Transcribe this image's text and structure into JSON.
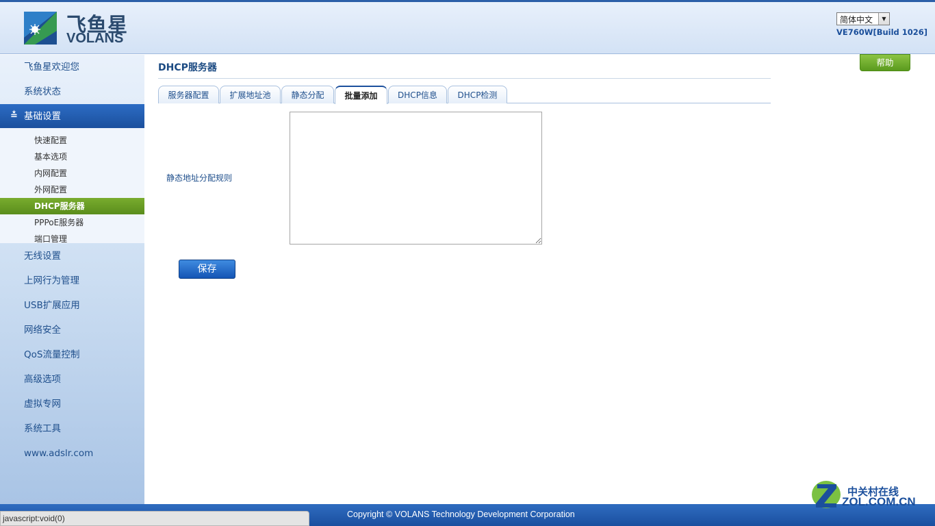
{
  "header": {
    "logo_cn": "飞鱼星",
    "logo_en": "VOLANS",
    "language": "简体中文",
    "model": "VE760W[Build 1026]"
  },
  "sidebar": {
    "items": [
      {
        "label": "飞鱼星欢迎您"
      },
      {
        "label": "系统状态"
      },
      {
        "label": "基础设置",
        "expanded": true
      },
      {
        "label": "无线设置"
      },
      {
        "label": "上网行为管理"
      },
      {
        "label": "USB扩展应用"
      },
      {
        "label": "网络安全"
      },
      {
        "label": "QoS流量控制"
      },
      {
        "label": "高级选项"
      },
      {
        "label": "虚拟专网"
      },
      {
        "label": "系统工具"
      },
      {
        "label": "www.adslr.com"
      }
    ],
    "subitems": [
      {
        "label": "快速配置"
      },
      {
        "label": "基本选项"
      },
      {
        "label": "内网配置"
      },
      {
        "label": "外网配置"
      },
      {
        "label": "DHCP服务器",
        "active": true
      },
      {
        "label": "PPPoE服务器"
      },
      {
        "label": "端口管理"
      }
    ]
  },
  "main": {
    "title": "DHCP服务器",
    "help_label": "帮助",
    "tabs": [
      {
        "label": "服务器配置"
      },
      {
        "label": "扩展地址池"
      },
      {
        "label": "静态分配"
      },
      {
        "label": "批量添加",
        "active": true
      },
      {
        "label": "DHCP信息"
      },
      {
        "label": "DHCP检测"
      }
    ],
    "rule_label": "静态地址分配规则",
    "rule_value": "",
    "save_label": "保存"
  },
  "footer": {
    "copyright": "Copyright © VOLANS Technology Development Corporation",
    "status_text": "javascript:void(0)"
  },
  "watermark": {
    "cn": "中关村在线",
    "en": "ZOL.COM.CN"
  },
  "colors": {
    "accent_blue": "#1b4f9c",
    "active_green": "#5a8d1c",
    "link_blue": "#1f4f8c"
  }
}
